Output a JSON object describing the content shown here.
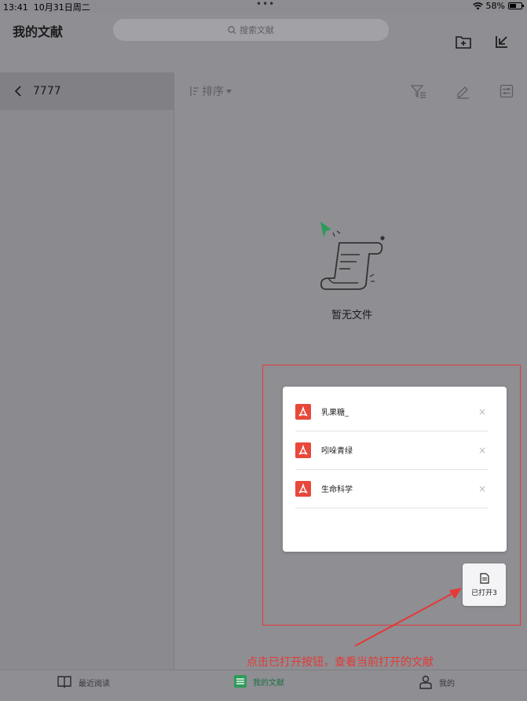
{
  "status_bar": {
    "time": "13:41",
    "date": "10月31日周二",
    "battery": "58%",
    "battery_level": 0.58,
    "dots": "•••"
  },
  "header": {
    "title": "我的文献",
    "search": {
      "placeholder": "搜索文献",
      "icon": "search-icon"
    },
    "actions": [
      {
        "icon": "add-folder-icon"
      },
      {
        "icon": "import-icon"
      }
    ]
  },
  "sidebar": {
    "folder": {
      "icon": "chevron-left-icon",
      "label": "7777"
    }
  },
  "toolbar": {
    "sort_label": "排序",
    "actions": [
      {
        "icon": "filter-icon"
      },
      {
        "icon": "edit-icon"
      },
      {
        "icon": "settings-icon"
      }
    ]
  },
  "empty_state": {
    "label": "暂无文件"
  },
  "popup": {
    "items": [
      {
        "name": "乳果糖_",
        "icon": "pdf-icon"
      },
      {
        "name": "吲哚青绿",
        "icon": "pdf-icon"
      },
      {
        "name": "生命科学",
        "icon": "pdf-icon"
      }
    ],
    "close_glyph": "×"
  },
  "opened_button": {
    "label": "已打开3",
    "icon": "document-icon"
  },
  "annotation": {
    "text": "点击已打开按钮，查看当前打开的文献",
    "color": "#e53935"
  },
  "tabs": [
    {
      "label": "最近阅读",
      "icon": "book-icon",
      "active": false
    },
    {
      "label": "我的文献",
      "icon": "list-icon",
      "active": true
    },
    {
      "label": "我的",
      "icon": "user-icon",
      "active": false
    }
  ],
  "colors": {
    "accent": "#2e9b5a",
    "pdf": "#e8483a",
    "highlight": "#e53935"
  }
}
